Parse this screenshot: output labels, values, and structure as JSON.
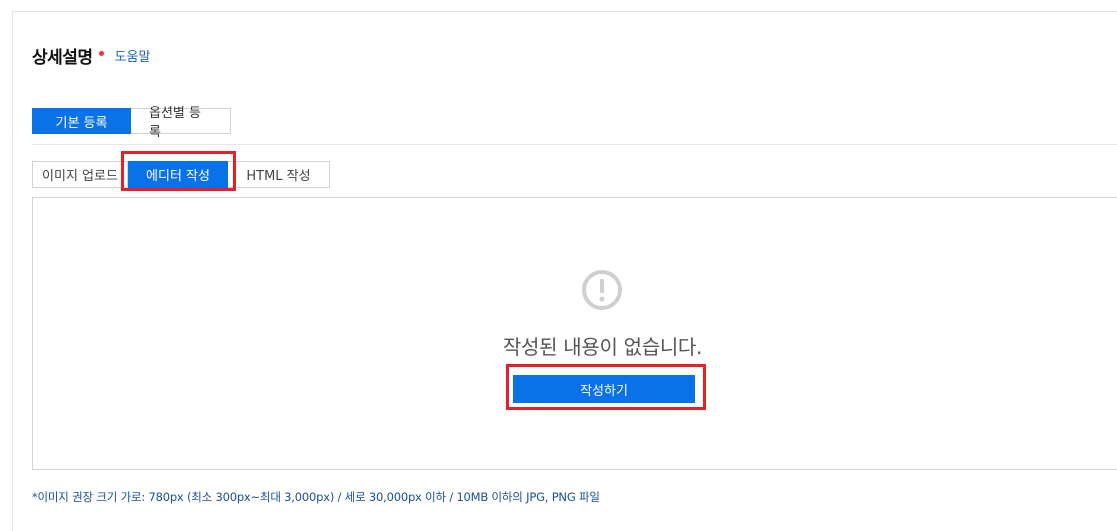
{
  "section": {
    "title": "상세설명",
    "help_link": "도움말"
  },
  "main_tabs": [
    {
      "label": "기본 등록",
      "active": true
    },
    {
      "label": "옵션별 등록",
      "active": false
    }
  ],
  "sub_tabs": [
    {
      "label": "이미지 업로드",
      "active": false
    },
    {
      "label": "에디터 작성",
      "active": true
    },
    {
      "label": "HTML 작성",
      "active": false
    }
  ],
  "editor": {
    "icon": "exclamation-circle-icon",
    "empty_message": "작성된 내용이 없습니다.",
    "write_button": "작성하기"
  },
  "note": "*이미지 권장 크기 가로: 780px (최소 300px~최대 3,000px) / 세로 30,000px 이하 / 10MB 이하의 JPG, PNG 파일",
  "colors": {
    "accent": "#0a72e8",
    "highlight": "#e5202b",
    "required_dot": "#f0333d",
    "link": "#1a61c9"
  }
}
